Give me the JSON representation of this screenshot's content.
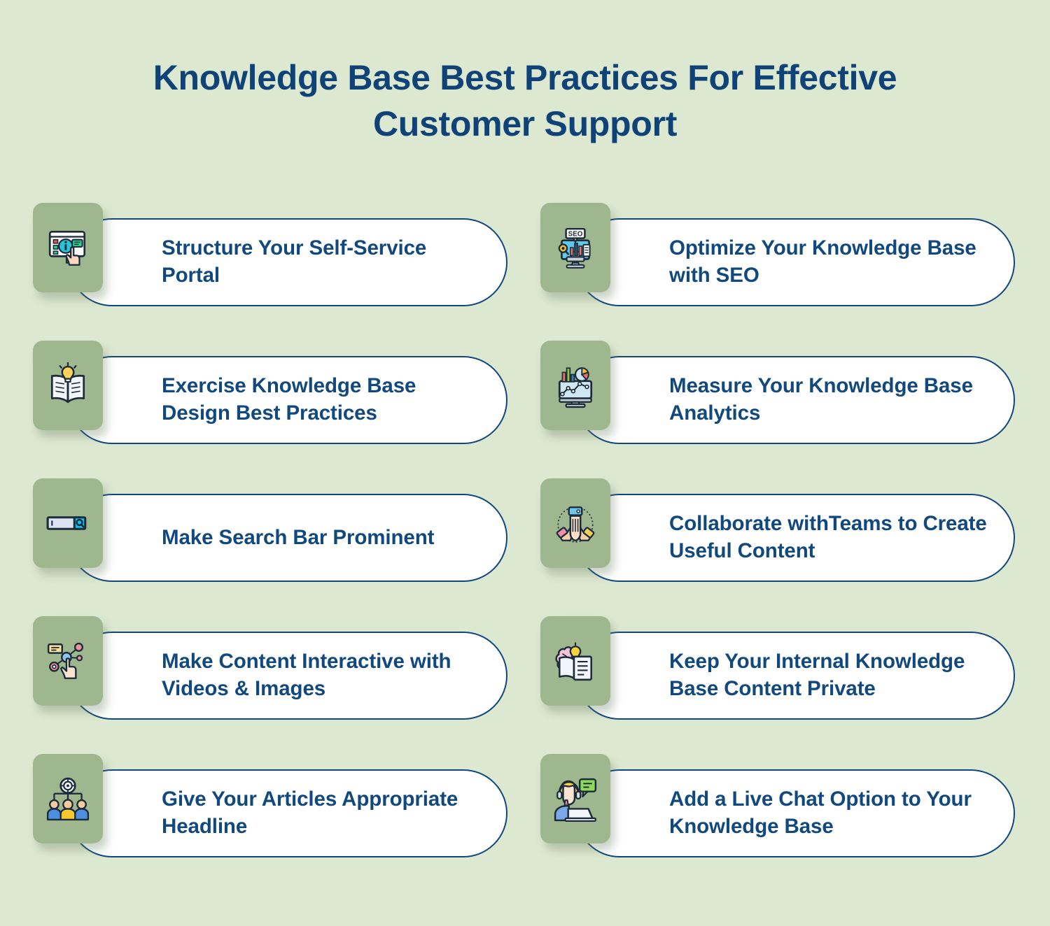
{
  "header": {
    "title": "Knowledge Base Best Practices For Effective Customer Support"
  },
  "colors": {
    "background": "#dde8d1",
    "title_text": "#0f4377",
    "item_text": "#11497f",
    "pill_border": "#11477e",
    "pill_fill": "#ffffff",
    "icon_tile": "#9fb78e"
  },
  "items": [
    {
      "id": 1,
      "column": "left",
      "row": 1,
      "label": "Structure Your Self-Service Portal",
      "icon": "portal-window-hand-icon"
    },
    {
      "id": 2,
      "column": "right",
      "row": 1,
      "label": "Optimize Your Knowledge Base with SEO",
      "icon": "seo-monitor-icon"
    },
    {
      "id": 3,
      "column": "left",
      "row": 2,
      "label": "Exercise Knowledge Base Design Best Practices",
      "icon": "open-book-lightbulb-icon"
    },
    {
      "id": 4,
      "column": "right",
      "row": 2,
      "label": "Measure Your Knowledge Base Analytics",
      "icon": "analytics-monitor-icon"
    },
    {
      "id": 5,
      "column": "left",
      "row": 3,
      "label": "Make Search Bar Prominent",
      "icon": "search-bar-icon"
    },
    {
      "id": 6,
      "column": "right",
      "row": 3,
      "label": "Collaborate withTeams to Create Useful Content",
      "icon": "teamwork-hands-icon"
    },
    {
      "id": 7,
      "column": "left",
      "row": 4,
      "label": "Make Content Interactive with Videos & Images",
      "icon": "interactive-nodes-hand-icon"
    },
    {
      "id": 8,
      "column": "right",
      "row": 4,
      "label": "Keep Your Internal Knowledge Base Content Private",
      "icon": "brain-book-lightbulb-icon"
    },
    {
      "id": 9,
      "column": "left",
      "row": 5,
      "label": "Give Your Articles Appropriate Headline",
      "icon": "team-target-icon"
    },
    {
      "id": 10,
      "column": "right",
      "row": 5,
      "label": "Add a Live Chat Option to Your Knowledge Base",
      "icon": "live-chat-agent-icon"
    }
  ]
}
